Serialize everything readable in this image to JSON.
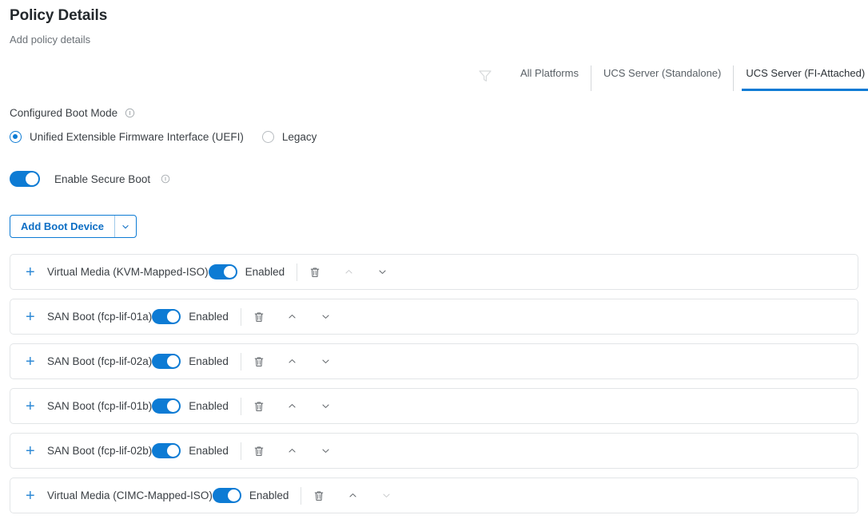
{
  "header": {
    "title": "Policy Details",
    "subtitle": "Add policy details"
  },
  "platform_filter": {
    "filter_icon": "funnel-icon",
    "tabs": [
      {
        "label": "All Platforms",
        "active": false
      },
      {
        "label": "UCS Server (Standalone)",
        "active": false
      },
      {
        "label": "UCS Server (FI-Attached)",
        "active": true
      }
    ],
    "accent_color": "#0d7bd4"
  },
  "boot_mode": {
    "label": "Configured Boot Mode",
    "info_icon": "info-icon",
    "options": [
      {
        "label": "Unified Extensible Firmware Interface (UEFI)",
        "selected": true
      },
      {
        "label": "Legacy",
        "selected": false
      }
    ]
  },
  "secure_boot": {
    "label": "Enable Secure Boot",
    "enabled": true,
    "info_icon": "info-icon"
  },
  "add_boot_device": {
    "label": "Add Boot Device",
    "caret_icon": "chevron-down-icon"
  },
  "devices": {
    "state_label": "Enabled",
    "expand_icon": "plus-icon",
    "delete_icon": "trash-icon",
    "move_up_icon": "chevron-up-icon",
    "move_down_icon": "chevron-down-icon",
    "items": [
      {
        "name": "Virtual Media (KVM-Mapped-ISO)",
        "state": "Enabled",
        "enabled": true,
        "can_move_up": false,
        "can_move_down": true
      },
      {
        "name": "SAN Boot (fcp-lif-01a)",
        "state": "Enabled",
        "enabled": true,
        "can_move_up": true,
        "can_move_down": true
      },
      {
        "name": "SAN Boot (fcp-lif-02a)",
        "state": "Enabled",
        "enabled": true,
        "can_move_up": true,
        "can_move_down": true
      },
      {
        "name": "SAN Boot (fcp-lif-01b)",
        "state": "Enabled",
        "enabled": true,
        "can_move_up": true,
        "can_move_down": true
      },
      {
        "name": "SAN Boot (fcp-lif-02b)",
        "state": "Enabled",
        "enabled": true,
        "can_move_up": true,
        "can_move_down": true
      },
      {
        "name": "Virtual Media (CIMC-Mapped-ISO)",
        "state": "Enabled",
        "enabled": true,
        "can_move_up": true,
        "can_move_down": false
      }
    ]
  }
}
